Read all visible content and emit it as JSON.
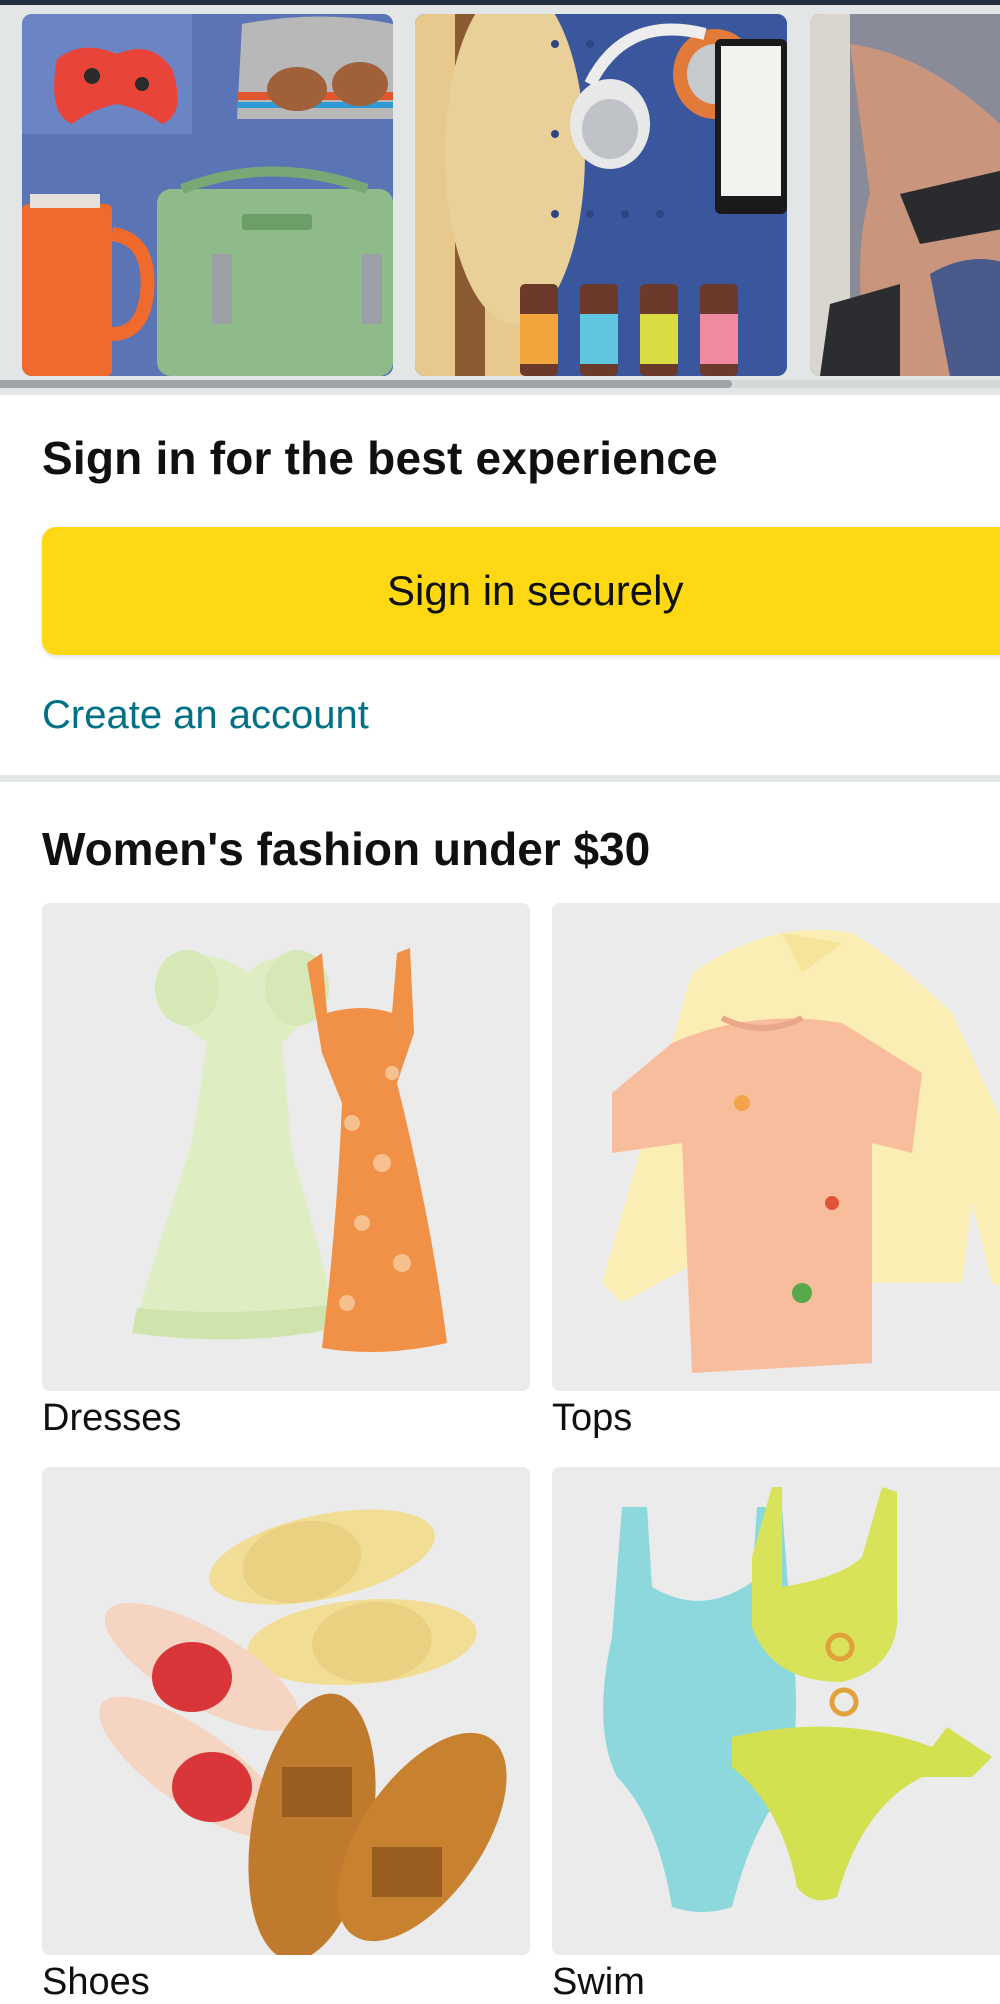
{
  "carousel": {
    "cards": [
      {
        "name": "gift-collage-stanley"
      },
      {
        "name": "gift-collage-headphones"
      },
      {
        "name": "phone-hand-photo"
      }
    ]
  },
  "signin": {
    "heading": "Sign in for the best experience",
    "button_label": "Sign in securely",
    "create_account_label": "Create an account"
  },
  "fashion": {
    "heading": "Women's fashion under $30",
    "tiles": [
      {
        "label": "Dresses"
      },
      {
        "label": "Tops"
      },
      {
        "label": "Shoes"
      },
      {
        "label": "Swim"
      }
    ]
  },
  "colors": {
    "accent_button": "#ffd814",
    "link": "#007185",
    "divider": "#e3e6e6",
    "text": "#0f1111"
  }
}
